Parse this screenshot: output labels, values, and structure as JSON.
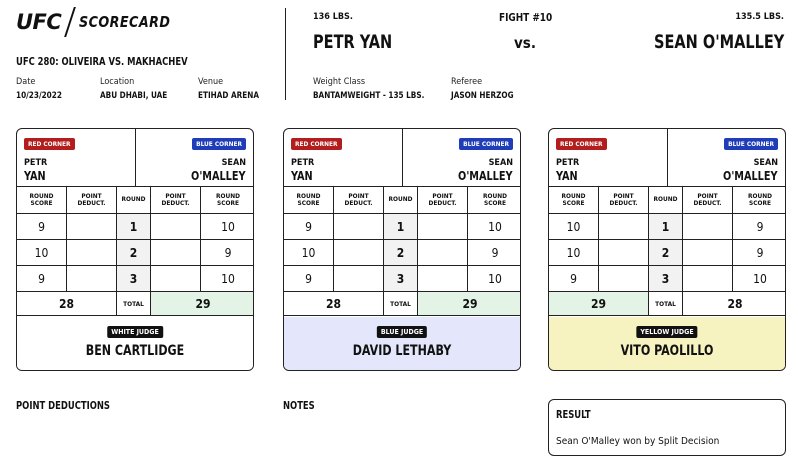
{
  "header": {
    "logo_text": "UFC",
    "scorecard_label": "SCORECARD",
    "event_title": "UFC 280: OLIVEIRA VS. MAKHACHEV",
    "date_label": "Date",
    "date_value": "10/23/2022",
    "location_label": "Location",
    "location_value": "ABU DHABI, UAE",
    "venue_label": "Venue",
    "venue_value": "ETIHAD ARENA"
  },
  "fight": {
    "number": "FIGHT #10",
    "vs": "vs.",
    "red_weight": "136 LBS.",
    "red_name": "PETR YAN",
    "blue_weight": "135.5 LBS.",
    "blue_name": "SEAN O'MALLEY",
    "weight_class_label": "Weight Class",
    "weight_class_value": "BANTAMWEIGHT - 135 LBS.",
    "referee_label": "Referee",
    "referee_value": "JASON HERZOG"
  },
  "card_labels": {
    "red_corner": "RED CORNER",
    "blue_corner": "BLUE CORNER",
    "round_score": "ROUND\nSCORE",
    "point_deduct": "POINT\nDEDUCT.",
    "round": "ROUND",
    "total": "TOTAL"
  },
  "cards": [
    {
      "red_first": "PETR",
      "red_last": "YAN",
      "blue_first": "SEAN",
      "blue_last": "O'MALLEY",
      "rounds": [
        {
          "red": "9",
          "red_ded": "",
          "round": "1",
          "blue_ded": "",
          "blue": "10"
        },
        {
          "red": "10",
          "red_ded": "",
          "round": "2",
          "blue_ded": "",
          "blue": "9"
        },
        {
          "red": "9",
          "red_ded": "",
          "round": "3",
          "blue_ded": "",
          "blue": "10"
        }
      ],
      "red_total": "28",
      "blue_total": "29",
      "judge_badge": "WHITE JUDGE",
      "judge_name": "BEN CARTLIDGE",
      "judge_color": "#ffffff"
    },
    {
      "red_first": "PETR",
      "red_last": "YAN",
      "blue_first": "SEAN",
      "blue_last": "O'MALLEY",
      "rounds": [
        {
          "red": "9",
          "red_ded": "",
          "round": "1",
          "blue_ded": "",
          "blue": "10"
        },
        {
          "red": "10",
          "red_ded": "",
          "round": "2",
          "blue_ded": "",
          "blue": "9"
        },
        {
          "red": "9",
          "red_ded": "",
          "round": "3",
          "blue_ded": "",
          "blue": "10"
        }
      ],
      "red_total": "28",
      "blue_total": "29",
      "judge_badge": "BLUE JUDGE",
      "judge_name": "DAVID LETHABY",
      "judge_color": "#e4e7fb"
    },
    {
      "red_first": "PETR",
      "red_last": "YAN",
      "blue_first": "SEAN",
      "blue_last": "O'MALLEY",
      "rounds": [
        {
          "red": "10",
          "red_ded": "",
          "round": "1",
          "blue_ded": "",
          "blue": "9"
        },
        {
          "red": "10",
          "red_ded": "",
          "round": "2",
          "blue_ded": "",
          "blue": "9"
        },
        {
          "red": "9",
          "red_ded": "",
          "round": "3",
          "blue_ded": "",
          "blue": "10"
        }
      ],
      "red_total": "29",
      "blue_total": "28",
      "judge_badge": "YELLOW JUDGE",
      "judge_name": "VITO PAOLILLO",
      "judge_color": "#f7f3c0"
    }
  ],
  "sections": {
    "point_deductions": "POINT DEDUCTIONS",
    "notes": "NOTES",
    "result_title": "RESULT",
    "result_text": "Sean O'Malley won by Split Decision"
  },
  "colors": {
    "red_corner": "#b21e1e",
    "blue_corner": "#1f3db8",
    "winner_fill": "#e3f4e6"
  }
}
